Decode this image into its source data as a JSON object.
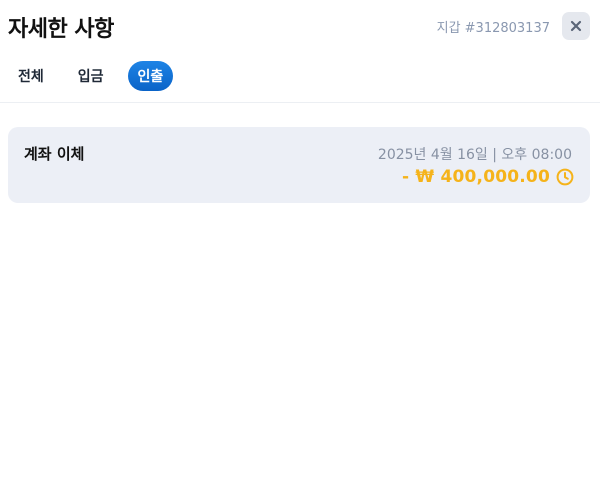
{
  "header": {
    "title": "자세한 사항",
    "wallet_label": "지갑 #312803137",
    "close_icon": "close-icon"
  },
  "tabs": [
    {
      "label": "전체",
      "active": false
    },
    {
      "label": "입금",
      "active": false
    },
    {
      "label": "인출",
      "active": true
    }
  ],
  "transactions": [
    {
      "type": "계좌 이체",
      "datetime": "2025년 4월 16일 | 오후 08:00",
      "amount": "- ₩ 400,000.00",
      "status_icon": "clock-icon",
      "status_color": "#f5b31a"
    }
  ],
  "colors": {
    "accent": "#0a63c8",
    "pending": "#f5b31a",
    "card_bg": "#eceff6"
  }
}
